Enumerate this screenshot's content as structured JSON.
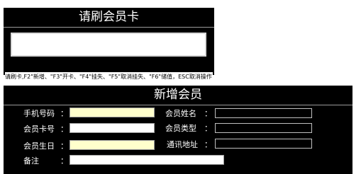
{
  "card_panel": {
    "title": "请刷会员卡",
    "input_value": "",
    "hint": "请刷卡,F2\"新增、\"F3\"开卡、\"F4\"挂失、\"F5\"取消挂失、\"F6\"储值，ESC取消操作"
  },
  "member_panel": {
    "title": "新增会员",
    "fields": {
      "phone": {
        "label": "手机号码",
        "colon": "：",
        "value": ""
      },
      "card_no": {
        "label": "会员卡号",
        "colon": "：",
        "value": ""
      },
      "birthday": {
        "label": "会员生日",
        "colon": "：",
        "value": ""
      },
      "remark": {
        "label": "备注",
        "colon": "：",
        "value": ""
      },
      "name": {
        "label": "会员姓名",
        "colon": "：",
        "value": ""
      },
      "type": {
        "label": "会员类型",
        "colon": "：",
        "value": ""
      },
      "address": {
        "label": "通讯地址",
        "colon": "：",
        "value": ""
      }
    }
  },
  "colors": {
    "panel_bg": "#000000",
    "highlight_input": "#ffffcc",
    "input_border": "#9a9a9a"
  }
}
